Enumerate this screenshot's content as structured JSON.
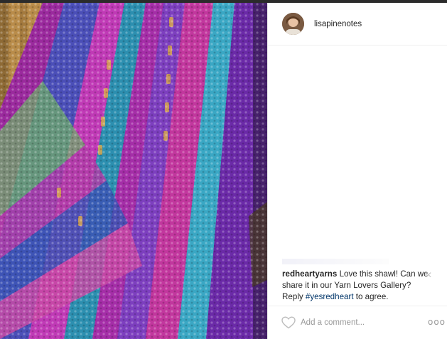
{
  "post": {
    "photo_icon": "crochet-shawl-photo",
    "author": {
      "username": "lisapinenotes",
      "avatar_icon": "user-avatar"
    },
    "comment": {
      "username": "redheartyarns",
      "text": " Love this shawl! Can we share it in our Yarn Lovers Gallery? Reply ",
      "hashtag": "#yesredheart",
      "suffix": " to agree."
    },
    "close_glyph": "✕",
    "actions": {
      "like_icon": "heart-icon",
      "comment_placeholder": "Add a comment...",
      "more_glyph": "ooo"
    }
  },
  "colors": {
    "accent_link": "#003569",
    "text": "#262626",
    "muted": "#999999"
  }
}
